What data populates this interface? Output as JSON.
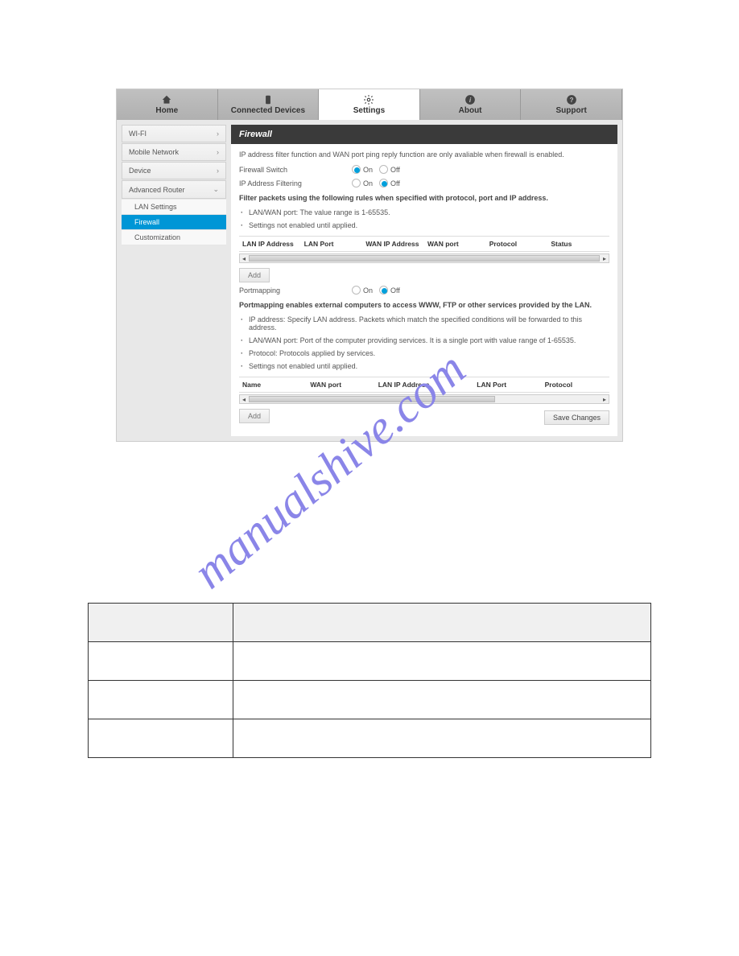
{
  "nav": {
    "home": "Home",
    "connected": "Connected Devices",
    "settings": "Settings",
    "about": "About",
    "support": "Support"
  },
  "sidebar": {
    "wifi": "WI-FI",
    "mobile": "Mobile Network",
    "device": "Device",
    "advanced": "Advanced Router",
    "lan": "LAN Settings",
    "firewall": "Firewall",
    "custom": "Customization"
  },
  "panel": {
    "title": "Firewall",
    "intro": "IP address filter function and WAN port ping reply function are only avaliable when firewall is enabled.",
    "firewall_switch": "Firewall Switch",
    "ip_filtering": "IP Address Filtering",
    "on": "On",
    "off": "Off",
    "filter_desc": "Filter packets using the following rules when specified with protocol, port and IP address.",
    "bullet_lanwan": "LAN/WAN port: The value range is 1-65535.",
    "bullet_notapplied": "Settings not enabled until applied.",
    "th_lanip": "LAN IP Address",
    "th_lanport": "LAN Port",
    "th_wanip": "WAN IP Address",
    "th_wanport": "WAN port",
    "th_protocol": "Protocol",
    "th_status": "Status",
    "add": "Add",
    "portmapping": "Portmapping",
    "portmap_desc": "Portmapping enables external computers to access WWW, FTP or other services provided by the LAN.",
    "pm_b1": "IP address: Specify LAN address. Packets which match the specified conditions will be forwarded to this address.",
    "pm_b2": "LAN/WAN port: Port of the computer providing services. It is a single port with value range of 1-65535.",
    "pm_b3": "Protocol: Protocols applied by services.",
    "pm_b4": "Settings not enabled until applied.",
    "th2_name": "Name",
    "th2_wanport": "WAN port",
    "th2_lanip": "LAN IP Address",
    "th2_lanport": "LAN Port",
    "th2_protocol": "Protocol",
    "save": "Save Changes"
  },
  "watermark": "manualshive.com"
}
